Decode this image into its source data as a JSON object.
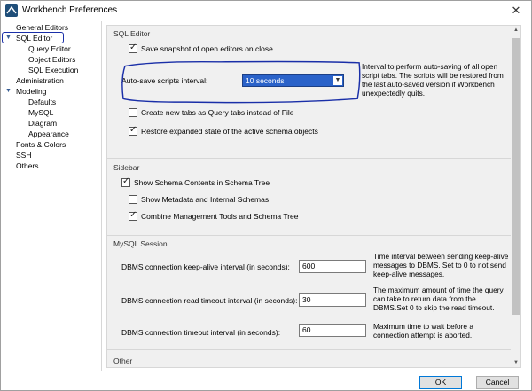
{
  "window": {
    "title": "Workbench Preferences"
  },
  "sidebar": {
    "items": [
      {
        "label": "General Editors"
      },
      {
        "label": "SQL Editor"
      },
      {
        "label": "Query Editor"
      },
      {
        "label": "Object Editors"
      },
      {
        "label": "SQL Execution"
      },
      {
        "label": "Administration"
      },
      {
        "label": "Modeling"
      },
      {
        "label": "Defaults"
      },
      {
        "label": "MySQL"
      },
      {
        "label": "Diagram"
      },
      {
        "label": "Appearance"
      },
      {
        "label": "Fonts & Colors"
      },
      {
        "label": "SSH"
      },
      {
        "label": "Others"
      }
    ]
  },
  "sql_editor": {
    "title": "SQL Editor",
    "save_snapshot": {
      "label": "Save snapshot of open editors on close",
      "checked": true
    },
    "autosave": {
      "label": "Auto-save scripts interval:",
      "value": "10 seconds",
      "help": "Interval to perform auto-saving of all open script tabs. The scripts will be restored from the last auto-saved version if Workbench unexpectedly quits."
    },
    "query_tabs": {
      "label": "Create new tabs as Query tabs instead of File",
      "checked": false
    },
    "restore_state": {
      "label": "Restore expanded state of the active schema objects",
      "checked": true
    }
  },
  "sidebar_section": {
    "title": "Sidebar",
    "schema_contents": {
      "label": "Show Schema Contents in Schema Tree",
      "checked": true
    },
    "metadata": {
      "label": "Show Metadata and Internal Schemas",
      "checked": false
    },
    "combine": {
      "label": "Combine Management Tools and Schema Tree",
      "checked": true
    }
  },
  "mysql_session": {
    "title": "MySQL Session",
    "keepalive": {
      "label": "DBMS connection keep-alive interval (in seconds):",
      "value": "600",
      "help": "Time interval between sending keep-alive messages to DBMS. Set to 0 to not send keep-alive messages."
    },
    "read_timeout": {
      "label": "DBMS connection read timeout interval (in seconds):",
      "value": "30",
      "help": "The maximum amount of time the query can take to return data from the DBMS.Set 0 to skip the read timeout."
    },
    "conn_timeout": {
      "label": "DBMS connection timeout interval (in seconds):",
      "value": "60",
      "help": "Maximum time to wait before a connection attempt is aborted."
    }
  },
  "other_section": {
    "title": "Other"
  },
  "buttons": {
    "ok": "OK",
    "cancel": "Cancel"
  },
  "colors": {
    "annotation": "#1a2fa8",
    "select_bg": "#2a62c9"
  }
}
